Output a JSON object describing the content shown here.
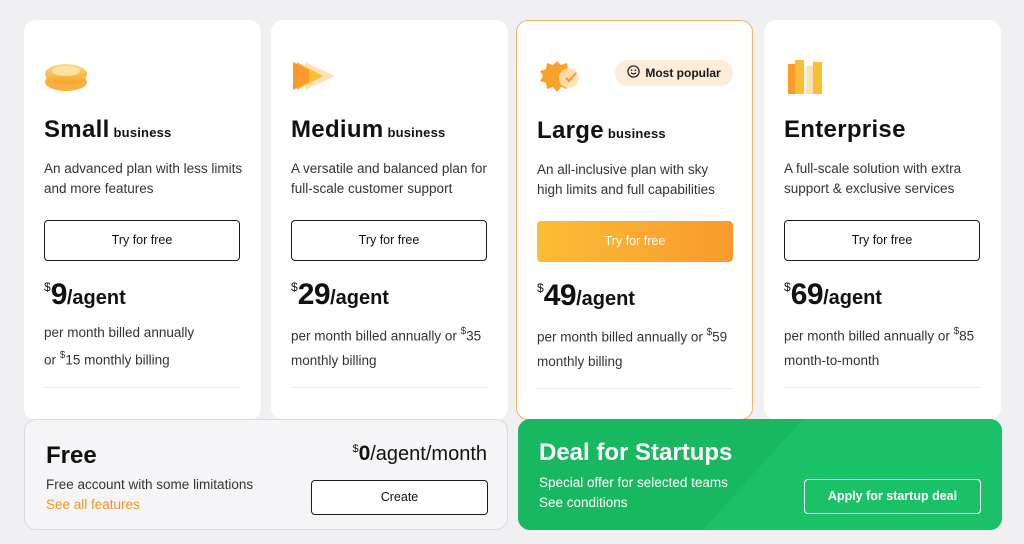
{
  "plans": [
    {
      "name": "Small",
      "name_suffix": "business",
      "description": "An advanced plan with less limits and more features",
      "cta": "Try for free",
      "currency": "$",
      "price": "9",
      "price_unit": "/agent",
      "billing_prefix": "per month billed annually",
      "billing_alt_prefix": "or ",
      "billing_alt_currency": "$",
      "billing_alt_price": "15",
      "billing_alt_suffix": " monthly billing",
      "icon": "small-plan-icon"
    },
    {
      "name": "Medium",
      "name_suffix": "business",
      "description": "A versatile and balanced plan for full-scale customer support",
      "cta": "Try for free",
      "currency": "$",
      "price": "29",
      "price_unit": "/agent",
      "billing_prefix": "per month billed annually or ",
      "billing_alt_currency": "$",
      "billing_alt_price": "35",
      "billing_alt_suffix": "monthly billing",
      "icon": "medium-plan-icon"
    },
    {
      "name": "Large",
      "name_suffix": "business",
      "description": "An all-inclusive plan with sky high limits and full capabilities",
      "cta": "Try for free",
      "currency": "$",
      "price": "49",
      "price_unit": "/agent",
      "billing_prefix": "per month billed annually or ",
      "billing_alt_currency": "$",
      "billing_alt_price": "59",
      "billing_alt_suffix": "monthly billing",
      "badge": "Most popular",
      "icon": "large-plan-icon"
    },
    {
      "name": "Enterprise",
      "description": "A full-scale solution with extra support & exclusive services",
      "cta": "Try for free",
      "currency": "$",
      "price": "69",
      "price_unit": "/agent",
      "billing_prefix": "per month billed annually or ",
      "billing_alt_currency": "$",
      "billing_alt_price": "85",
      "billing_alt_suffix": "month-to-month",
      "icon": "enterprise-plan-icon"
    }
  ],
  "free": {
    "title": "Free",
    "currency": "$",
    "price": "0",
    "price_unit": "/agent/month",
    "description": "Free account with some limitations",
    "link": "See all features",
    "cta": "Create"
  },
  "startup": {
    "title": "Deal for Startups",
    "description": "Special offer for selected teams",
    "link": "See conditions",
    "cta": "Apply for startup deal"
  },
  "colors": {
    "accent_orange": "#f99a2d",
    "accent_yellow": "#fbbd35",
    "startup_green": "#17b860",
    "link_orange": "#f5921e"
  }
}
